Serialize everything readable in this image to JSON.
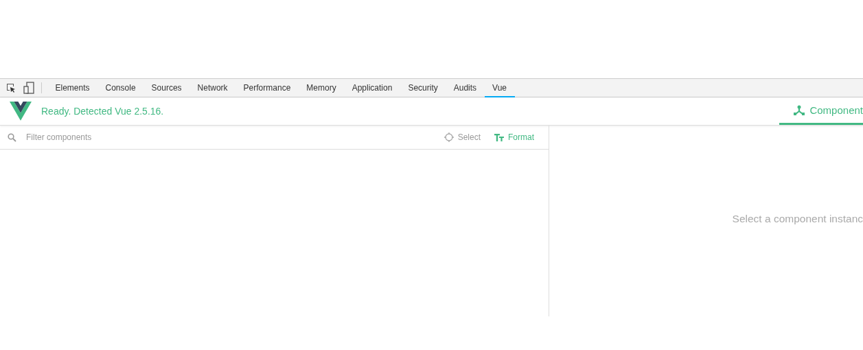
{
  "devtools_tabs": [
    {
      "label": "Elements",
      "selected": false
    },
    {
      "label": "Console",
      "selected": false
    },
    {
      "label": "Sources",
      "selected": false
    },
    {
      "label": "Network",
      "selected": false
    },
    {
      "label": "Performance",
      "selected": false
    },
    {
      "label": "Memory",
      "selected": false
    },
    {
      "label": "Application",
      "selected": false
    },
    {
      "label": "Security",
      "selected": false
    },
    {
      "label": "Audits",
      "selected": false
    },
    {
      "label": "Vue",
      "selected": true
    }
  ],
  "vue_header": {
    "status": "Ready. Detected Vue 2.5.16.",
    "tabs": [
      {
        "label": "Component",
        "selected": true
      }
    ]
  },
  "filter_bar": {
    "placeholder": "Filter components",
    "select_label": "Select",
    "format_label": "Format"
  },
  "inspector": {
    "empty_message": "Select a component instanc"
  }
}
